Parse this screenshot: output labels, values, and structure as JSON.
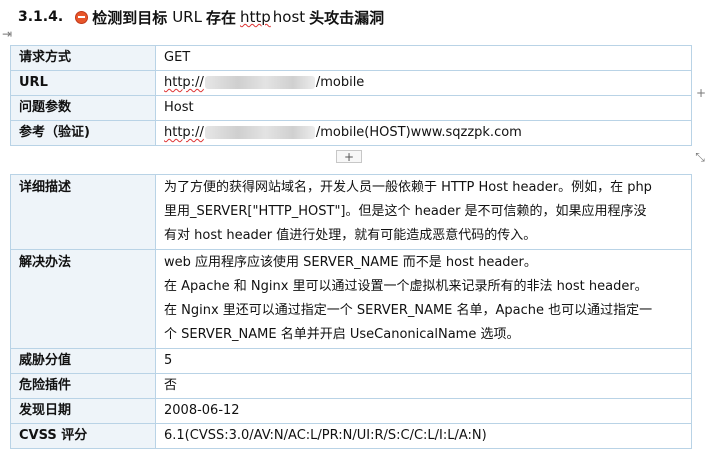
{
  "heading": {
    "number": "3.1.4.",
    "title_pre": "检测到目标",
    "title_url": "URL",
    "title_mid": "存在",
    "title_http": "http",
    "title_host": "host",
    "title_post": "头攻击漏洞"
  },
  "table1": {
    "rows": [
      {
        "label": "请求方式",
        "value": "GET"
      },
      {
        "label": "URL",
        "value_pre": "http://",
        "value_post": "/mobile"
      },
      {
        "label": "问题参数",
        "value": "Host"
      },
      {
        "label": "参考（验证)",
        "value_pre": "http://",
        "value_post": "/mobile(HOST)www.sqzzpk.com"
      }
    ],
    "add_button": "+"
  },
  "side_buttons": {
    "left_arrow": "⇥",
    "right_plus": "+",
    "resize": "⤡"
  },
  "table2": {
    "rows": [
      {
        "label": "详细描述",
        "lines": [
          "为了方便的获得网站域名，开发人员一般依赖于 HTTP Host header。例如，在 php",
          "里用_SERVER[\"HTTP_HOST\"]。但是这个 header 是不可信赖的，如果应用程序没",
          "有对 host header 值进行处理，就有可能造成恶意代码的传入。"
        ]
      },
      {
        "label": "解决办法",
        "lines": [
          "web 应用程序应该使用 SERVER_NAME 而不是 host header。",
          "在 Apache 和 Nginx 里可以通过设置一个虚拟机来记录所有的非法 host header。",
          "在 Nginx 里还可以通过指定一个 SERVER_NAME 名单，Apache 也可以通过指定一",
          "个 SERVER_NAME 名单并开启 UseCanonicalName 选项。"
        ]
      },
      {
        "label": "威胁分值",
        "value": "5"
      },
      {
        "label": "危险插件",
        "value": "否"
      },
      {
        "label": "发现日期",
        "value": "2008-06-12"
      },
      {
        "label": "CVSS 评分",
        "value": "6.1(CVSS:3.0/AV:N/AC:L/PR:N/UI:R/S:C/C:L/I:L/A:N)"
      }
    ]
  }
}
